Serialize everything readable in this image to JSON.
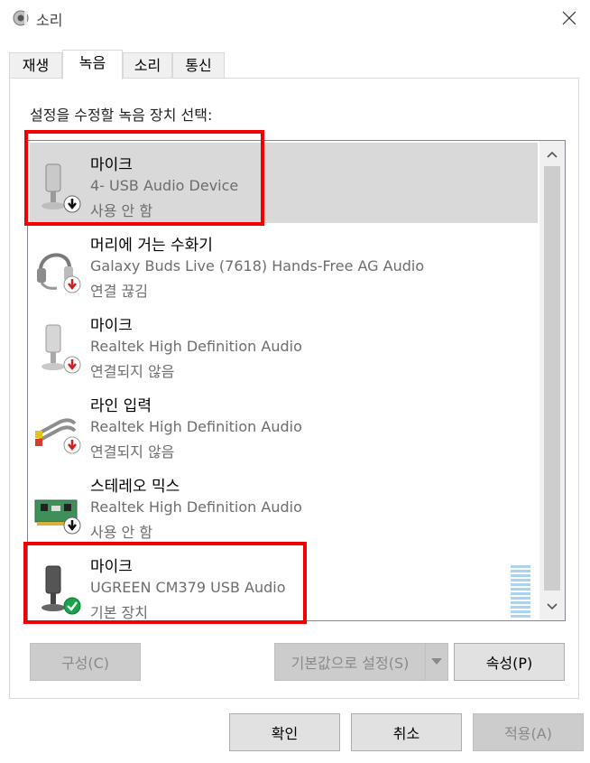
{
  "window": {
    "title": "소리",
    "close_icon": "close-icon",
    "app_icon": "speaker-icon"
  },
  "tabs": [
    {
      "label": "재생",
      "active": false
    },
    {
      "label": "녹음",
      "active": true
    },
    {
      "label": "소리",
      "active": false
    },
    {
      "label": "통신",
      "active": false
    }
  ],
  "instruction": "설정을 수정할 녹음 장치 선택:",
  "devices": [
    {
      "name": "마이크",
      "driver": "4- USB Audio Device",
      "status": "사용 안 함",
      "icon": "microphone-icon",
      "badge": "disabled-arrow-icon",
      "selected": true
    },
    {
      "name": "머리에 거는 수화기",
      "driver": "Galaxy Buds Live (7618) Hands-Free AG Audio",
      "status": "연결 끊김",
      "icon": "headset-icon",
      "badge": "disconnected-arrow-icon",
      "selected": false
    },
    {
      "name": "마이크",
      "driver": "Realtek High Definition Audio",
      "status": "연결되지 않음",
      "icon": "microphone-icon",
      "badge": "disconnected-arrow-icon",
      "selected": false
    },
    {
      "name": "라인 입력",
      "driver": "Realtek High Definition Audio",
      "status": "연결되지 않음",
      "icon": "line-in-cable-icon",
      "badge": "disconnected-arrow-icon",
      "selected": false
    },
    {
      "name": "스테레오 믹스",
      "driver": "Realtek High Definition Audio",
      "status": "사용 안 함",
      "icon": "sound-card-icon",
      "badge": "disabled-arrow-icon",
      "selected": false
    },
    {
      "name": "마이크",
      "driver": "UGREEN CM379 USB Audio",
      "status": "기본 장치",
      "icon": "microphone-icon",
      "badge": "default-check-icon",
      "selected": false
    }
  ],
  "buttons": {
    "configure": "구성(C)",
    "set_default": "기본값으로 설정(S)",
    "properties": "속성(P)",
    "ok": "확인",
    "cancel": "취소",
    "apply": "적용(A)"
  },
  "colors": {
    "highlight": "#f00000",
    "selected_row": "#d9d9d9",
    "default_badge": "#16a34a",
    "disconnected_badge": "#d21f1f"
  }
}
